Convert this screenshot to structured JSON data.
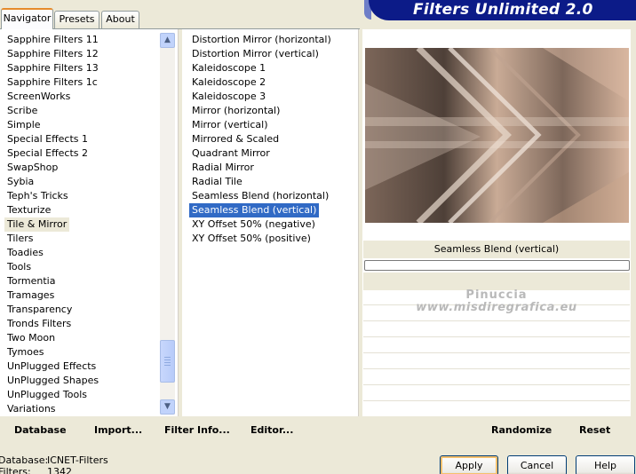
{
  "tabs": [
    {
      "label": "Navigator",
      "active": true
    },
    {
      "label": "Presets",
      "active": false
    },
    {
      "label": "About",
      "active": false
    }
  ],
  "banner": {
    "title": "Filters Unlimited 2.0"
  },
  "categories": {
    "items": [
      "Sapphire Filters 11",
      "Sapphire Filters 12",
      "Sapphire Filters 13",
      "Sapphire Filters 1c",
      "ScreenWorks",
      "Scribe",
      "Simple",
      "Special Effects 1",
      "Special Effects 2",
      "SwapShop",
      "Sybia",
      "Teph's Tricks",
      "Texturize",
      "Tile & Mirror",
      "Tilers",
      "Toadies",
      "Tools",
      "Tormentia",
      "Tramages",
      "Transparency",
      "Tronds Filters",
      "Two Moon",
      "Tymoes",
      "UnPlugged Effects",
      "UnPlugged Shapes",
      "UnPlugged Tools",
      "Variations"
    ],
    "selected": "Tile & Mirror"
  },
  "filters": {
    "items": [
      "Distortion Mirror (horizontal)",
      "Distortion Mirror (vertical)",
      "Kaleidoscope 1",
      "Kaleidoscope 2",
      "Kaleidoscope 3",
      "Mirror (horizontal)",
      "Mirror (vertical)",
      "Mirrored & Scaled",
      "Quadrant Mirror",
      "Radial Mirror",
      "Radial Tile",
      "Seamless Blend (horizontal)",
      "Seamless Blend (vertical)",
      "XY Offset 50% (negative)",
      "XY Offset 50% (positive)"
    ],
    "selected": "Seamless Blend (vertical)"
  },
  "preview": {
    "filter_name": "Seamless Blend (vertical)",
    "progress": 0,
    "watermark_line1": "Pinuccia",
    "watermark_line2": "www.misdiregrafica.eu"
  },
  "toolbar": {
    "database_label": "Database",
    "import_label": "Import...",
    "filter_info_label": "Filter Info...",
    "editor_label": "Editor...",
    "randomize_label": "Randomize",
    "reset_label": "Reset"
  },
  "status": {
    "database_label": "Database:",
    "database_value": "ICNET-Filters",
    "filters_label": "Filters:",
    "filters_value": "1342"
  },
  "buttons": {
    "apply_label": "Apply",
    "cancel_label": "Cancel",
    "help_label": "Help"
  },
  "icons": {
    "scroll_up": "chevron-up-icon",
    "scroll_down": "chevron-down-icon"
  },
  "colors": {
    "selection": "#316ac5",
    "banner": "#0c1b88",
    "tab_accent": "#e68b2c"
  }
}
